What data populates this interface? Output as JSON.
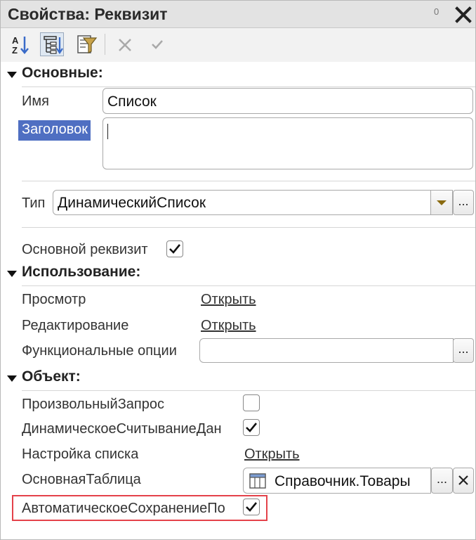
{
  "window": {
    "title": "Свойства: Реквизит",
    "pin_text": "0",
    "close_glyph": "✕"
  },
  "toolbar": {
    "buttons": [
      {
        "name": "sort-alphabet-button",
        "icon": "sort-az-icon"
      },
      {
        "name": "categories-button",
        "icon": "categories-tree-icon",
        "active": true
      },
      {
        "name": "filter-button",
        "icon": "filter-icon"
      },
      {
        "name": "cancel-button",
        "icon": "cross-icon"
      },
      {
        "name": "apply-button",
        "icon": "check-icon"
      }
    ]
  },
  "groups": {
    "main": {
      "title": "Основные:"
    },
    "usage": {
      "title": "Использование:"
    },
    "object": {
      "title": "Объект:"
    }
  },
  "main": {
    "name_label": "Имя",
    "name_value": "Список",
    "caption_label": "Заголовок",
    "caption_value": "",
    "type_label": "Тип",
    "type_value": "ДинамическийСписок",
    "main_attr_label": "Основной реквизит",
    "main_attr_checked": true
  },
  "usage": {
    "view_label": "Просмотр",
    "view_link": "Открыть",
    "edit_label": "Редактирование",
    "edit_link": "Открыть",
    "func_options_label": "Функциональные опции",
    "func_options_value": ""
  },
  "object": {
    "custom_query_label": "ПроизвольныйЗапрос",
    "custom_query_checked": false,
    "dynamic_read_label": "ДинамическоеСчитываниеДан",
    "dynamic_read_checked": true,
    "list_settings_label": "Настройка списка",
    "list_settings_link": "Открыть",
    "main_table_label": "ОсновнаяТаблица",
    "main_table_value": "Справочник.Товары",
    "autosave_label": "АвтоматическоеСохранениеПо",
    "autosave_checked": true
  },
  "common": {
    "ellipsis": "...",
    "clear_glyph": "✕",
    "check_glyph": "✔"
  },
  "colors": {
    "selection": "#4f6fc2",
    "highlight": "#e4424a",
    "titlebar": "#e3e3e3"
  }
}
